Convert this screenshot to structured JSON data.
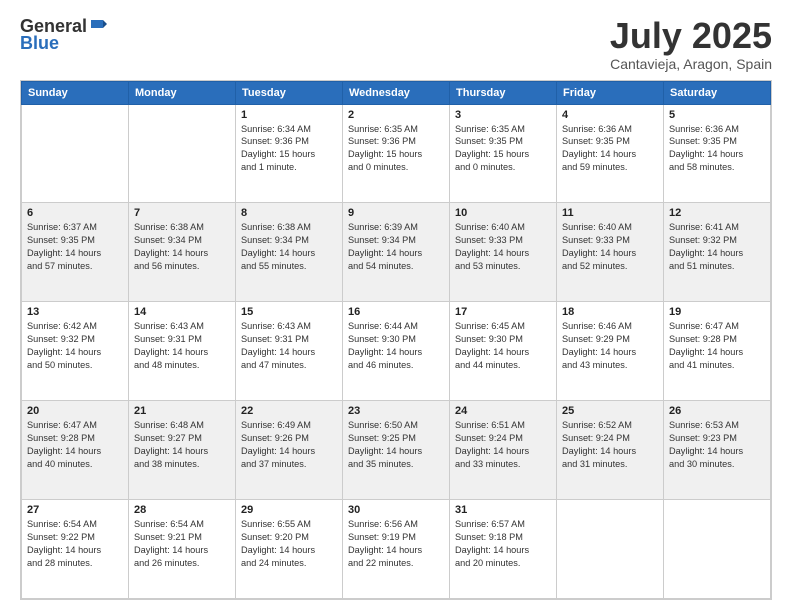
{
  "header": {
    "logo": {
      "line1": "General",
      "line2": "Blue"
    },
    "title": "July 2025",
    "location": "Cantavieja, Aragon, Spain"
  },
  "calendar": {
    "weekdays": [
      "Sunday",
      "Monday",
      "Tuesday",
      "Wednesday",
      "Thursday",
      "Friday",
      "Saturday"
    ],
    "weeks": [
      [
        {
          "day": "",
          "info": ""
        },
        {
          "day": "",
          "info": ""
        },
        {
          "day": "1",
          "info": "Sunrise: 6:34 AM\nSunset: 9:36 PM\nDaylight: 15 hours\nand 1 minute."
        },
        {
          "day": "2",
          "info": "Sunrise: 6:35 AM\nSunset: 9:36 PM\nDaylight: 15 hours\nand 0 minutes."
        },
        {
          "day": "3",
          "info": "Sunrise: 6:35 AM\nSunset: 9:35 PM\nDaylight: 15 hours\nand 0 minutes."
        },
        {
          "day": "4",
          "info": "Sunrise: 6:36 AM\nSunset: 9:35 PM\nDaylight: 14 hours\nand 59 minutes."
        },
        {
          "day": "5",
          "info": "Sunrise: 6:36 AM\nSunset: 9:35 PM\nDaylight: 14 hours\nand 58 minutes."
        }
      ],
      [
        {
          "day": "6",
          "info": "Sunrise: 6:37 AM\nSunset: 9:35 PM\nDaylight: 14 hours\nand 57 minutes."
        },
        {
          "day": "7",
          "info": "Sunrise: 6:38 AM\nSunset: 9:34 PM\nDaylight: 14 hours\nand 56 minutes."
        },
        {
          "day": "8",
          "info": "Sunrise: 6:38 AM\nSunset: 9:34 PM\nDaylight: 14 hours\nand 55 minutes."
        },
        {
          "day": "9",
          "info": "Sunrise: 6:39 AM\nSunset: 9:34 PM\nDaylight: 14 hours\nand 54 minutes."
        },
        {
          "day": "10",
          "info": "Sunrise: 6:40 AM\nSunset: 9:33 PM\nDaylight: 14 hours\nand 53 minutes."
        },
        {
          "day": "11",
          "info": "Sunrise: 6:40 AM\nSunset: 9:33 PM\nDaylight: 14 hours\nand 52 minutes."
        },
        {
          "day": "12",
          "info": "Sunrise: 6:41 AM\nSunset: 9:32 PM\nDaylight: 14 hours\nand 51 minutes."
        }
      ],
      [
        {
          "day": "13",
          "info": "Sunrise: 6:42 AM\nSunset: 9:32 PM\nDaylight: 14 hours\nand 50 minutes."
        },
        {
          "day": "14",
          "info": "Sunrise: 6:43 AM\nSunset: 9:31 PM\nDaylight: 14 hours\nand 48 minutes."
        },
        {
          "day": "15",
          "info": "Sunrise: 6:43 AM\nSunset: 9:31 PM\nDaylight: 14 hours\nand 47 minutes."
        },
        {
          "day": "16",
          "info": "Sunrise: 6:44 AM\nSunset: 9:30 PM\nDaylight: 14 hours\nand 46 minutes."
        },
        {
          "day": "17",
          "info": "Sunrise: 6:45 AM\nSunset: 9:30 PM\nDaylight: 14 hours\nand 44 minutes."
        },
        {
          "day": "18",
          "info": "Sunrise: 6:46 AM\nSunset: 9:29 PM\nDaylight: 14 hours\nand 43 minutes."
        },
        {
          "day": "19",
          "info": "Sunrise: 6:47 AM\nSunset: 9:28 PM\nDaylight: 14 hours\nand 41 minutes."
        }
      ],
      [
        {
          "day": "20",
          "info": "Sunrise: 6:47 AM\nSunset: 9:28 PM\nDaylight: 14 hours\nand 40 minutes."
        },
        {
          "day": "21",
          "info": "Sunrise: 6:48 AM\nSunset: 9:27 PM\nDaylight: 14 hours\nand 38 minutes."
        },
        {
          "day": "22",
          "info": "Sunrise: 6:49 AM\nSunset: 9:26 PM\nDaylight: 14 hours\nand 37 minutes."
        },
        {
          "day": "23",
          "info": "Sunrise: 6:50 AM\nSunset: 9:25 PM\nDaylight: 14 hours\nand 35 minutes."
        },
        {
          "day": "24",
          "info": "Sunrise: 6:51 AM\nSunset: 9:24 PM\nDaylight: 14 hours\nand 33 minutes."
        },
        {
          "day": "25",
          "info": "Sunrise: 6:52 AM\nSunset: 9:24 PM\nDaylight: 14 hours\nand 31 minutes."
        },
        {
          "day": "26",
          "info": "Sunrise: 6:53 AM\nSunset: 9:23 PM\nDaylight: 14 hours\nand 30 minutes."
        }
      ],
      [
        {
          "day": "27",
          "info": "Sunrise: 6:54 AM\nSunset: 9:22 PM\nDaylight: 14 hours\nand 28 minutes."
        },
        {
          "day": "28",
          "info": "Sunrise: 6:54 AM\nSunset: 9:21 PM\nDaylight: 14 hours\nand 26 minutes."
        },
        {
          "day": "29",
          "info": "Sunrise: 6:55 AM\nSunset: 9:20 PM\nDaylight: 14 hours\nand 24 minutes."
        },
        {
          "day": "30",
          "info": "Sunrise: 6:56 AM\nSunset: 9:19 PM\nDaylight: 14 hours\nand 22 minutes."
        },
        {
          "day": "31",
          "info": "Sunrise: 6:57 AM\nSunset: 9:18 PM\nDaylight: 14 hours\nand 20 minutes."
        },
        {
          "day": "",
          "info": ""
        },
        {
          "day": "",
          "info": ""
        }
      ]
    ]
  }
}
